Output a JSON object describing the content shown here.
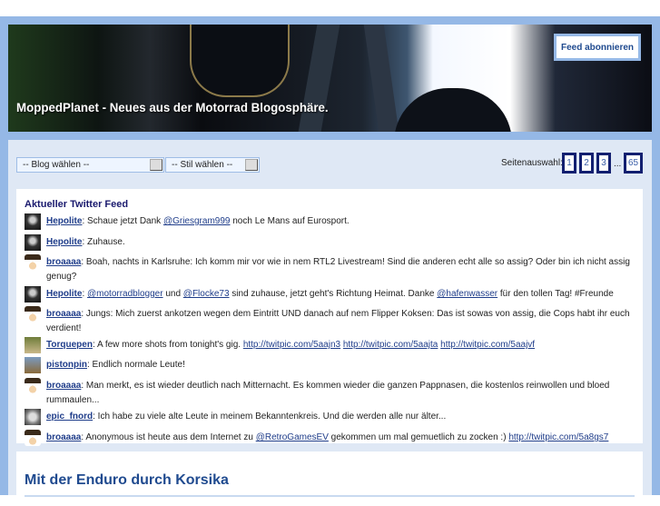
{
  "header": {
    "site_title": "MoppedPlanet - Neues aus der Motorrad Blogosphäre.",
    "feed_button": "Feed abonnieren"
  },
  "filters": {
    "blog_select": "-- Blog wählen --",
    "style_select": "-- Stil wählen --"
  },
  "pager": {
    "label": "Seitenauswahl:",
    "pages": [
      "1",
      "2",
      "3",
      "65"
    ],
    "ellipsis": "..."
  },
  "twitter": {
    "title": "Aktueller Twitter Feed",
    "tweets": [
      {
        "user": "Hepolite",
        "parts": [
          ": Schaue jetzt Dank ",
          "@Griesgram999",
          " noch Le Mans auf Eurosport."
        ]
      },
      {
        "user": "Hepolite",
        "parts": [
          ": Zuhause."
        ]
      },
      {
        "user": "broaaaa",
        "parts": [
          ": Boah, nachts in Karlsruhe: Ich komm mir vor wie in nem RTL2 Livestream! Sind die anderen echt alle so assig? Oder bin ich nicht assig genug?"
        ]
      },
      {
        "user": "Hepolite",
        "parts": [
          ": ",
          "@motorradblogger",
          " und ",
          "@Flocke73",
          " sind zuhause, jetzt geht's Richtung Heimat. Danke ",
          "@hafenwasser",
          " für den tollen Tag! #Freunde"
        ]
      },
      {
        "user": "broaaaa",
        "parts": [
          ": Jungs: Mich zuerst ankotzen wegen dem Eintritt UND danach auf nem Flipper Koksen: Das ist sowas von assig, die Cops habt ihr euch verdient!"
        ]
      },
      {
        "user": "Torquepen",
        "parts": [
          ": A few more shots from tonight's gig. ",
          "http://twitpic.com/5aajn3",
          " ",
          "http://twitpic.com/5aajta",
          " ",
          "http://twitpic.com/5aajvf"
        ]
      },
      {
        "user": "pistonpin",
        "parts": [
          ": Endlich normale Leute!"
        ]
      },
      {
        "user": "broaaaa",
        "parts": [
          ": Man merkt, es ist wieder deutlich nach Mitternacht. Es kommen wieder die ganzen Pappnasen, die kostenlos reinwollen und bloed rummaulen..."
        ]
      },
      {
        "user": "epic_fnord",
        "parts": [
          ": Ich habe zu viele alte Leute in meinem Bekanntenkreis. Und die werden alle nur älter..."
        ]
      },
      {
        "user": "broaaaa",
        "parts": [
          ": Anonymous ist heute aus dem Internet zu ",
          "@RetroGamesEV",
          " gekommen um mal gemuetlich zu zocken :) ",
          "http://twitpic.com/5a8gs7"
        ]
      }
    ]
  },
  "post": {
    "title": "Mit der Enduro durch Korsika"
  }
}
